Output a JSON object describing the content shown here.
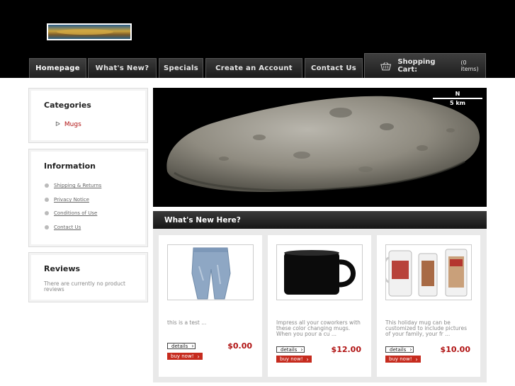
{
  "nav": {
    "items": [
      "Homepage",
      "What's New?",
      "Specials",
      "Create an Account",
      "Contact Us"
    ],
    "active_index": 0
  },
  "cart": {
    "label": "Shopping Cart:",
    "count": "(0 items)",
    "icon": "basket-icon"
  },
  "sidebar": {
    "categories": {
      "title": "Categories",
      "items": [
        "Mugs"
      ]
    },
    "information": {
      "title": "Information",
      "items": [
        "Shipping & Returns",
        "Privacy Notice",
        "Conditions of Use",
        "Contact Us"
      ]
    },
    "reviews": {
      "title": "Reviews",
      "text": "There are currently no product reviews"
    }
  },
  "banner": {
    "north_label": "N",
    "scale_label": "5 km"
  },
  "whats_new": {
    "title": "What's New Here?",
    "details_label": "details",
    "buy_label": "buy now!",
    "products": [
      {
        "description": "this is a test ...",
        "price": "$0.00",
        "image": "jeans-image"
      },
      {
        "description": "Impress all your coworkers with these color changing mugs. When you pour a cu ...",
        "price": "$12.00",
        "image": "black-mug-image"
      },
      {
        "description": "This holiday mug can be customized to include pictures of your family, your fr ...",
        "price": "$10.00",
        "image": "holiday-mugs-image"
      }
    ]
  },
  "colors": {
    "accent_red": "#b01212",
    "buy_button": "#c62b1e",
    "header_bg": "#000000"
  }
}
